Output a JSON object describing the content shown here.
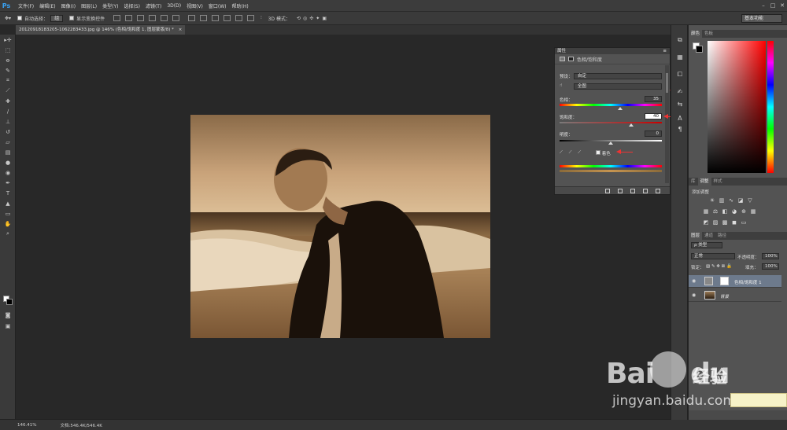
{
  "app": {
    "logo": "Ps"
  },
  "menu": [
    "文件(F)",
    "编辑(E)",
    "图像(I)",
    "图层(L)",
    "类型(Y)",
    "选择(S)",
    "滤镜(T)",
    "3D(D)",
    "视图(V)",
    "窗口(W)",
    "帮助(H)"
  ],
  "options": {
    "auto_select_label": "自动选择：",
    "auto_select_value": "组",
    "show_transform_label": "显示变换控件",
    "mode_3d_label": "3D 模式：",
    "workspace": "基本功能"
  },
  "document": {
    "tab_label": "20120918183205-1062283433.jpg @ 146% (色相/饱和度 1, 图层蒙版/8) *",
    "close_glyph": "×"
  },
  "status": {
    "zoom": "146.41%",
    "doc_size": "文档:546.4K/546.4K"
  },
  "properties": {
    "header": "属性",
    "title": "色相/饱和度",
    "preset_label": "预设：",
    "preset_value": "自定",
    "channel_value": "全图",
    "hue_label": "色相：",
    "hue_value": "35",
    "hue_fraction": 0.596,
    "saturation_label": "饱和度：",
    "saturation_value": "40",
    "saturation_fraction": 0.7,
    "lightness_label": "明度：",
    "lightness_value": "0",
    "lightness_fraction": 0.5,
    "colorize_label": "着色",
    "colorize_checked": true
  },
  "right_panels": {
    "color_tabs": [
      "颜色",
      "色板"
    ],
    "adjust_tabs": [
      "库",
      "调整",
      "样式"
    ],
    "adjust_title": "添加调整",
    "layers_tabs": [
      "图层",
      "通道",
      "路径"
    ],
    "kind_filter": "ρ 类型",
    "blend_mode": "正常",
    "opacity_label": "不透明度：",
    "opacity_value": "100%",
    "lock_label": "锁定：",
    "fill_label": "填充：",
    "fill_value": "100%",
    "layers": [
      {
        "name": "色相/饱和度 1"
      },
      {
        "name": "背景"
      }
    ]
  },
  "watermark": {
    "brand": "Bai",
    "brand2": "du",
    "jingyan": "经验",
    "url": "jingyan.baidu.com"
  },
  "colors": {
    "accent": "#39a0f0",
    "arrow": "#e33333"
  }
}
